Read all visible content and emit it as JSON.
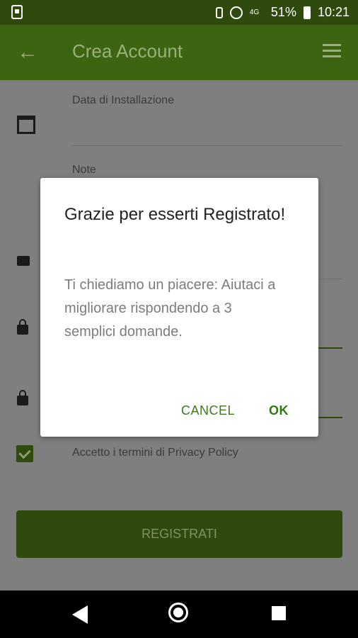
{
  "status_bar": {
    "battery_percent": "51%",
    "time": "10:21",
    "signal_label": "4G"
  },
  "app_bar": {
    "title": "Crea Account",
    "back_icon": "arrow-back",
    "menu_icon": "hamburger-menu"
  },
  "form": {
    "installation_label": "Data di Installazione",
    "notes_label": "Note",
    "privacy_label": "Accetto i termini di Privacy Policy",
    "privacy_checked": true,
    "register_button": "REGISTRATI"
  },
  "dialog": {
    "title": "Grazie per esserti Registrato!",
    "message": "Ti chiediamo un piacere: Aiutaci a migliorare rispondendo a 3 semplici domande.",
    "cancel": "CANCEL",
    "ok": "OK"
  },
  "nav_bar": {
    "back_icon": "nav-back",
    "home_icon": "nav-home",
    "recents_icon": "nav-recents"
  },
  "colors": {
    "status_bar": "#2e4a0d",
    "app_bar": "#3d6410",
    "accent_green": "#2f7a0f",
    "overlay": "#7f7f7f"
  }
}
